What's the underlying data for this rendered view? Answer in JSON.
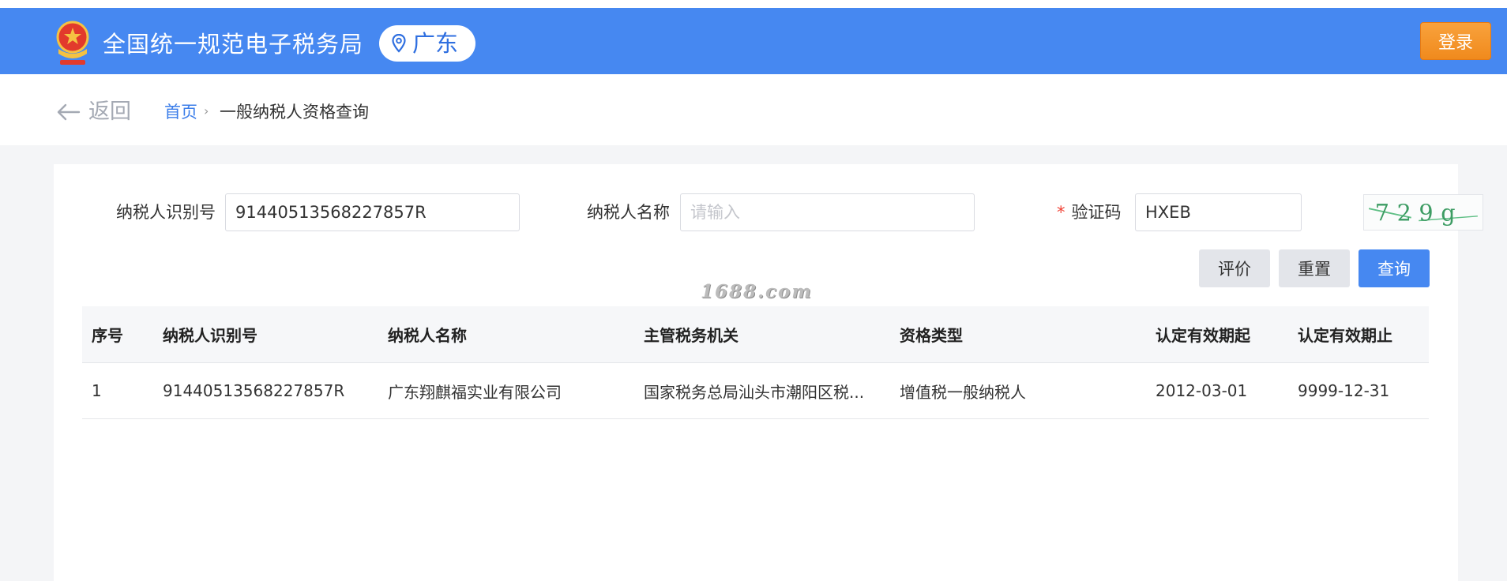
{
  "header": {
    "site_title": "全国统一规范电子税务局",
    "region": "广东",
    "login_label": "登录",
    "brand_color": "#4688f1",
    "login_color": "#f39422"
  },
  "breadcrumb": {
    "back_label": "返回",
    "home": "首页",
    "separator": "›",
    "current": "一般纳税人资格查询"
  },
  "form": {
    "taxpayer_id_label": "纳税人识别号",
    "taxpayer_id_value": "91440513568227857R",
    "taxpayer_name_label": "纳税人名称",
    "taxpayer_name_placeholder": "请输入",
    "captcha_required_mark": "*",
    "captcha_label": "验证码",
    "captcha_value": "HXEB",
    "captcha_image_text": "729g"
  },
  "buttons": {
    "evaluate": "评价",
    "reset": "重置",
    "query": "查询"
  },
  "watermark": "1688.com",
  "table": {
    "columns": [
      "序号",
      "纳税人识别号",
      "纳税人名称",
      "主管税务机关",
      "资格类型",
      "认定有效期起",
      "认定有效期止"
    ],
    "rows": [
      [
        "1",
        "91440513568227857R",
        "广东翔麒福实业有限公司",
        "国家税务总局汕头市潮阳区税...",
        "增值税一般纳税人",
        "2012-03-01",
        "9999-12-31"
      ]
    ]
  }
}
